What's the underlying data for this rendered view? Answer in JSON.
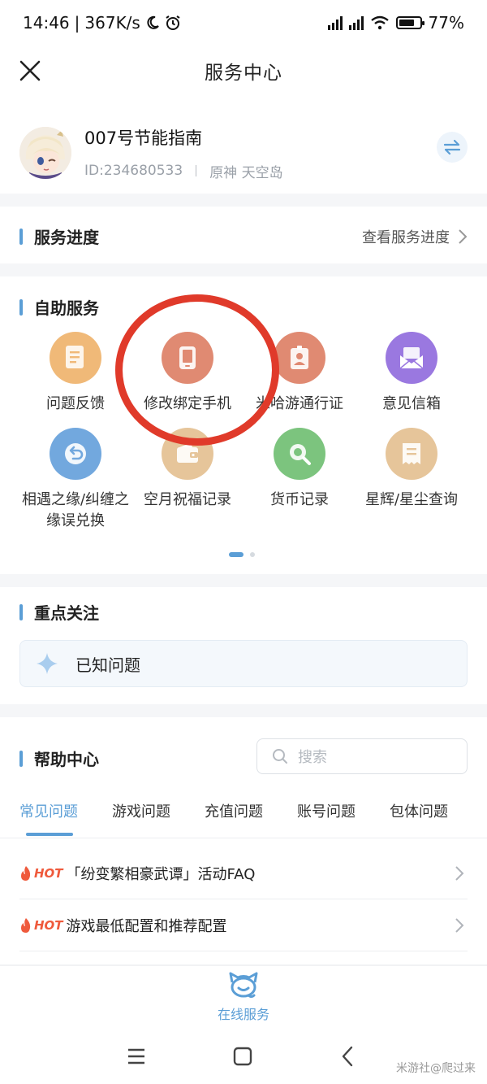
{
  "status": {
    "time": "14:46",
    "net_speed": "367K/s",
    "battery": "77%",
    "battery_level": 0.77
  },
  "header": {
    "title": "服务中心"
  },
  "profile": {
    "name": "007号节能指南",
    "id": "ID:234680533",
    "game": "原神",
    "server": "天空岛"
  },
  "service_progress": {
    "title": "服务进度",
    "link": "查看服务进度"
  },
  "self_service": {
    "title": "自助服务",
    "items": [
      {
        "label": "问题反馈",
        "color": "#f0b978",
        "icon": "document-icon"
      },
      {
        "label": "修改绑定手机",
        "color": "#e08a72",
        "icon": "phone-icon"
      },
      {
        "label": "米哈游通行证",
        "color": "#e08a72",
        "icon": "id-card-icon"
      },
      {
        "label": "意见信箱",
        "color": "#9a78e0",
        "icon": "mail-icon"
      },
      {
        "label": "相遇之缘/纠缠之缘误兑换",
        "color": "#72a8de",
        "icon": "undo-icon"
      },
      {
        "label": "空月祝福记录",
        "color": "#e6c59a",
        "icon": "wallet-icon"
      },
      {
        "label": "货币记录",
        "color": "#7cc47e",
        "icon": "magnifier-icon"
      },
      {
        "label": "星辉/星尘查询",
        "color": "#e6c59a",
        "icon": "receipt-icon"
      }
    ]
  },
  "focus": {
    "title": "重点关注",
    "known_issues": "已知问题"
  },
  "help": {
    "title": "帮助中心",
    "search_placeholder": "搜索",
    "tabs": [
      "常见问题",
      "游戏问题",
      "充值问题",
      "账号问题",
      "包体问题"
    ],
    "active_tab": 0,
    "hot_label": "HOT",
    "faqs": [
      "「纷变繁相豪武谭」活动FAQ",
      "游戏最低配置和推荐配置"
    ]
  },
  "bottom": {
    "online_service": "在线服务"
  },
  "watermark": "米游社@爬过来",
  "colors": {
    "accent": "#5b9ed6",
    "annotation": "#e03a2a",
    "hot": "#ef5a3c"
  }
}
